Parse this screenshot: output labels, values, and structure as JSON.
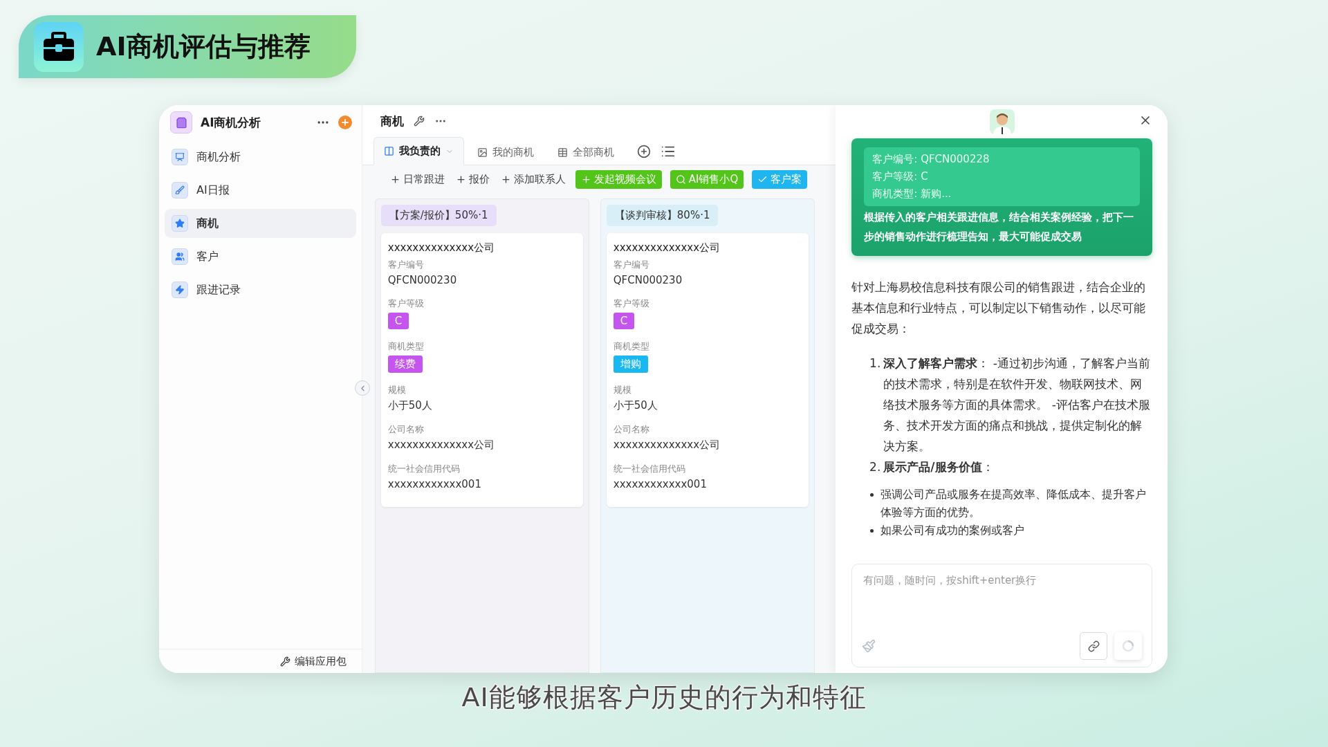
{
  "banner": {
    "title": "AI商机评估与推荐"
  },
  "sidebar": {
    "app_name": "AI商机分析",
    "items": [
      {
        "label": "商机分析",
        "selected": false
      },
      {
        "label": "AI日报",
        "selected": false
      },
      {
        "label": "商机",
        "selected": true
      },
      {
        "label": "客户",
        "selected": false
      },
      {
        "label": "跟进记录",
        "selected": false
      }
    ],
    "footer": "编辑应用包"
  },
  "main": {
    "title": "商机",
    "views": [
      {
        "label": "我负责的",
        "selected": true
      },
      {
        "label": "我的商机",
        "selected": false
      },
      {
        "label": "全部商机",
        "selected": false
      }
    ],
    "actions": [
      {
        "label": "日常跟进",
        "kind": "plain"
      },
      {
        "label": "报价",
        "kind": "plain"
      },
      {
        "label": "添加联系人",
        "kind": "plain"
      },
      {
        "label": "发起视频会议",
        "kind": "filled",
        "color": "#52c41a"
      },
      {
        "label": "AI销售小Q",
        "kind": "filled",
        "color": "#52c41a"
      },
      {
        "label": "客户案",
        "kind": "filled",
        "color": "#1fb6f0"
      }
    ],
    "columns": [
      {
        "title": "【方案/报价】50%·1",
        "color": "#e7defa",
        "cards": [
          {
            "company": "xxxxxxxxxxxxxx公司",
            "fields": [
              {
                "label": "客户编号",
                "value": "QFCN000230",
                "kind": "text"
              },
              {
                "label": "客户等级",
                "value": "C",
                "kind": "tag",
                "color": "#c655ef"
              },
              {
                "label": "商机类型",
                "value": "续费",
                "kind": "tag",
                "color": "#c655ef"
              },
              {
                "label": "规模",
                "value": "小于50人",
                "kind": "text"
              },
              {
                "label": "公司名称",
                "value": "xxxxxxxxxxxxxx公司",
                "kind": "text"
              },
              {
                "label": "统一社会信用代码",
                "value": "xxxxxxxxxxxx001",
                "kind": "text"
              }
            ]
          }
        ]
      },
      {
        "title": "【谈判审核】80%·1",
        "color": "#d8eff8",
        "cards": [
          {
            "company": "xxxxxxxxxxxxxx公司",
            "fields": [
              {
                "label": "客户编号",
                "value": "QFCN000230",
                "kind": "text"
              },
              {
                "label": "客户等级",
                "value": "C",
                "kind": "tag",
                "color": "#c655ef"
              },
              {
                "label": "商机类型",
                "value": "增购",
                "kind": "tag",
                "color": "#1ab8f0"
              },
              {
                "label": "规模",
                "value": "小于50人",
                "kind": "text"
              },
              {
                "label": "公司名称",
                "value": "xxxxxxxxxxxxxx公司",
                "kind": "text"
              },
              {
                "label": "统一社会信用代码",
                "value": "xxxxxxxxxxxx001",
                "kind": "text"
              }
            ]
          }
        ]
      }
    ]
  },
  "assistant": {
    "prompt_card": {
      "lines": [
        "客户编号: QFCN000228",
        "客户等级: C",
        "商机类型: 新购..."
      ],
      "instruction": "根据传入的客户相关跟进信息，结合相关案例经验，把下一步的销售动作进行梳理告知，最大可能促成交易"
    },
    "intro": "针对上海易校信息科技有限公司的销售跟进，结合企业的基本信息和行业特点，可以制定以下销售动作，以尽可能促成交易：",
    "steps": [
      {
        "number": "1.",
        "text": "**深入了解客户需求**：  -通过初步沟通，了解客户当前的技术需求，特别是在软件开发、物联网技术、网络技术服务等方面的具体需求。 -评估客户在技术服务、技术开发方面的痛点和挑战，提供定制化的解决方案。"
      },
      {
        "number": "2.",
        "text": "**展示产品/服务价值**："
      }
    ],
    "bullets": [
      "强调公司产品或服务在提高效率、降低成本、提升客户体验等方面的优势。",
      "如果公司有成功的案例或客户"
    ],
    "input": {
      "placeholder": "有问题，随时问，按shift+enter换行"
    }
  },
  "subtitle": "AI能够根据客户历史的行为和特征"
}
